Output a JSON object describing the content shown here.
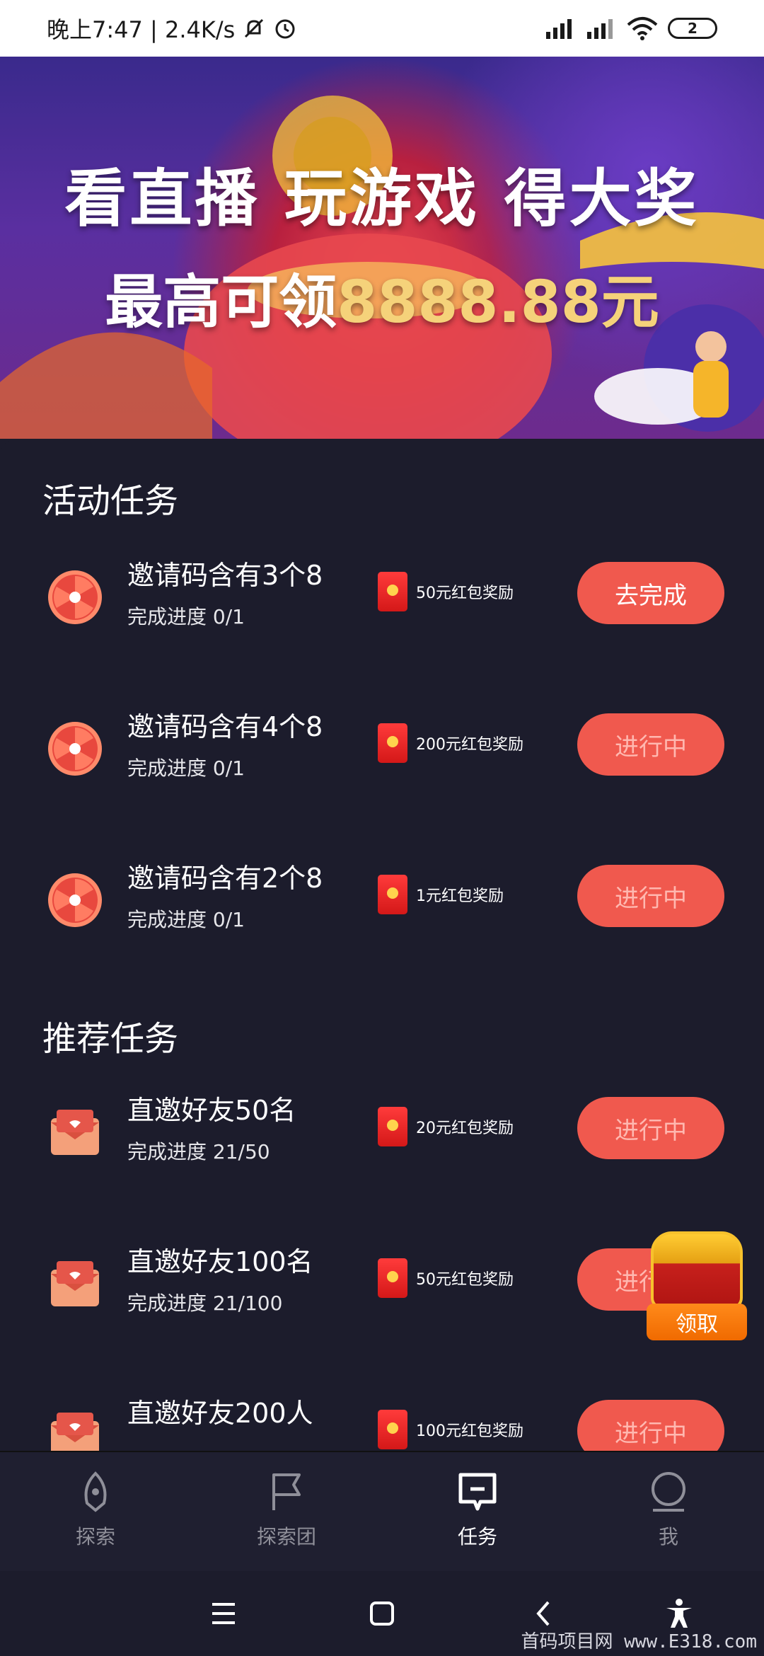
{
  "status_bar": {
    "time_speed": "晚上7:47 | 2.4K/s",
    "battery": "2"
  },
  "banner": {
    "title": "看直播 玩游戏 得大奖",
    "subtitle_prefix": "最高可领",
    "amount": "8888.88元"
  },
  "sections": {
    "activity_title": "活动任务",
    "recommend_title": "推荐任务"
  },
  "activity_tasks": [
    {
      "name": "邀请码含有3个8",
      "progress": "完成进度 0/1",
      "reward": "50元红包奖励",
      "button": "去完成"
    },
    {
      "name": "邀请码含有4个8",
      "progress": "完成进度 0/1",
      "reward": "200元红包奖励",
      "button": "进行中"
    },
    {
      "name": "邀请码含有2个8",
      "progress": "完成进度 0/1",
      "reward": "1元红包奖励",
      "button": "进行中"
    }
  ],
  "recommend_tasks": [
    {
      "name": "直邀好友50名",
      "progress": "完成进度 21/50",
      "reward": "20元红包奖励",
      "button": "进行中"
    },
    {
      "name": "直邀好友100名",
      "progress": "完成进度 21/100",
      "reward": "50元红包奖励",
      "button": "进行中"
    },
    {
      "name": "直邀好友200人",
      "progress": "",
      "reward": "100元红包奖励",
      "button": "进行中"
    }
  ],
  "chest": {
    "label": "领取"
  },
  "bottom_nav": [
    {
      "label": "探索",
      "icon": "rocket-icon"
    },
    {
      "label": "探索团",
      "icon": "flag-icon"
    },
    {
      "label": "任务",
      "icon": "task-icon"
    },
    {
      "label": "我",
      "icon": "profile-icon"
    }
  ],
  "watermark": "首码项目网 www.E318.com",
  "colors": {
    "accent": "#f0594e",
    "background": "#1c1c2c",
    "gold": "#f5d27a"
  }
}
